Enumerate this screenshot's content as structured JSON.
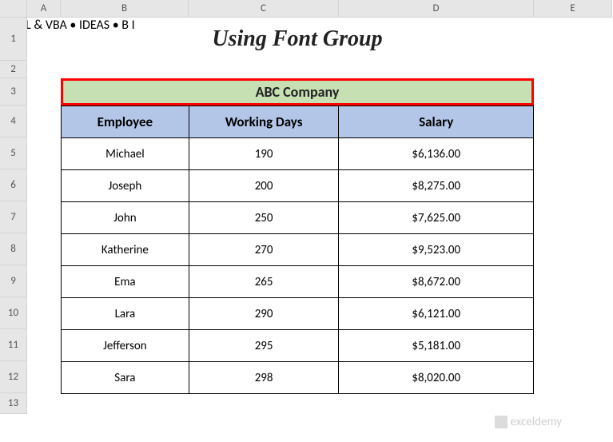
{
  "columns": [
    "",
    "A",
    "B",
    "C",
    "D",
    "E"
  ],
  "rows": [
    "1",
    "2",
    "3",
    "4",
    "5",
    "6",
    "7",
    "8",
    "9",
    "10",
    "11",
    "12",
    "13"
  ],
  "title": "Using Font Group",
  "merged": "ABC Company",
  "headers": {
    "employee": "Employee",
    "working_days": "Working Days",
    "salary": "Salary"
  },
  "data": [
    {
      "employee": "Michael",
      "working_days": "190",
      "salary": "$6,136.00"
    },
    {
      "employee": "Joseph",
      "working_days": "200",
      "salary": "$8,275.00"
    },
    {
      "employee": "John",
      "working_days": "250",
      "salary": "$7,625.00"
    },
    {
      "employee": "Katherine",
      "working_days": "270",
      "salary": "$9,523.00"
    },
    {
      "employee": "Ema",
      "working_days": "265",
      "salary": "$8,672.00"
    },
    {
      "employee": "Lara",
      "working_days": "290",
      "salary": "$6,121.00"
    },
    {
      "employee": "Jefferson",
      "working_days": "295",
      "salary": "$5,181.00"
    },
    {
      "employee": "Sara",
      "working_days": "298",
      "salary": "$8,020.00"
    }
  ],
  "watermark": {
    "brand": "exceldemy",
    "tagline": "EXCEL & VBA • IDEAS • B I"
  },
  "chart_data": {
    "type": "table",
    "title": "ABC Company",
    "columns": [
      "Employee",
      "Working Days",
      "Salary"
    ],
    "rows": [
      [
        "Michael",
        190,
        6136.0
      ],
      [
        "Joseph",
        200,
        8275.0
      ],
      [
        "John",
        250,
        7625.0
      ],
      [
        "Katherine",
        270,
        9523.0
      ],
      [
        "Ema",
        265,
        8672.0
      ],
      [
        "Lara",
        290,
        6121.0
      ],
      [
        "Jefferson",
        295,
        5181.0
      ],
      [
        "Sara",
        298,
        8020.0
      ]
    ]
  }
}
